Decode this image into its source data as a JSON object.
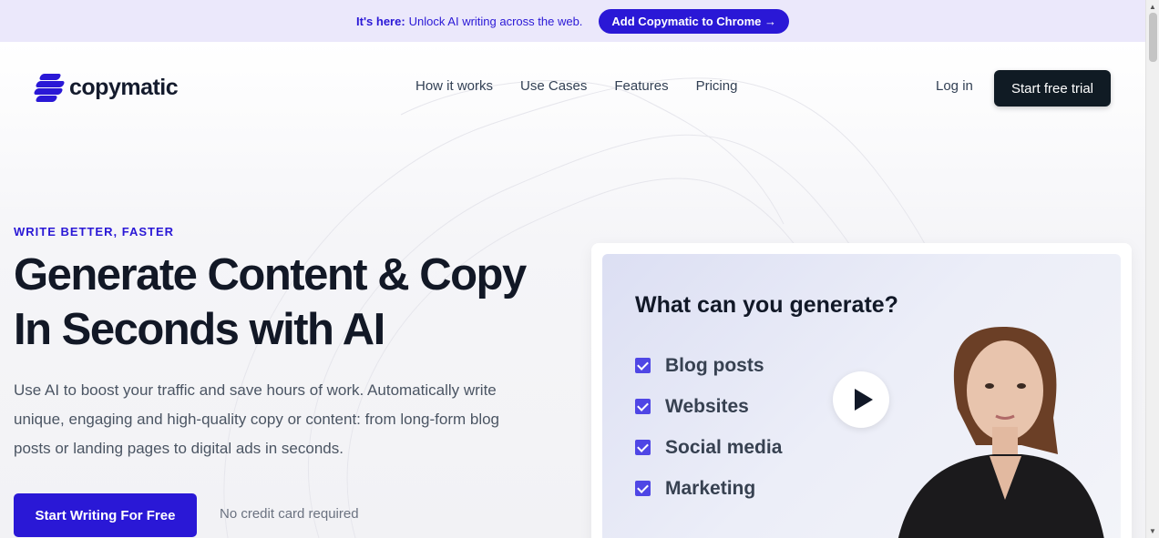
{
  "promo": {
    "strong": "It's here:",
    "text": "Unlock AI writing across the web.",
    "button": "Add Copymatic to Chrome →"
  },
  "brand": {
    "name": "copymatic",
    "color": "#2a18d6"
  },
  "nav": {
    "items": [
      "How it works",
      "Use Cases",
      "Features",
      "Pricing"
    ],
    "login": "Log in",
    "cta": "Start free trial"
  },
  "hero": {
    "eyebrow": "WRITE BETTER, FASTER",
    "headline_line1": "Generate Content & Copy",
    "headline_line2": "In Seconds with AI",
    "subtext": "Use AI to boost your traffic and save hours of work. Automatically write unique, engaging and high-quality copy or content: from long-form blog posts or landing pages to digital ads in seconds.",
    "cta": "Start Writing For Free",
    "note": "No credit card required"
  },
  "video": {
    "question": "What can you generate?",
    "items": [
      "Blog posts",
      "Websites",
      "Social media",
      "Marketing"
    ]
  },
  "colors": {
    "accent": "#2a18d6",
    "dark": "#101b24",
    "promo_bg": "#ebe8fb"
  }
}
